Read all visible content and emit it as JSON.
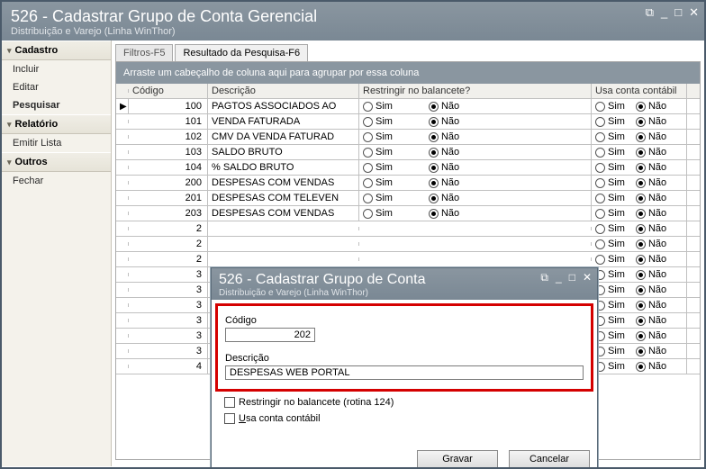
{
  "window": {
    "title": "526 - Cadastrar Grupo de Conta Gerencial",
    "subtitle": "Distribuição e Varejo (Linha WinThor)"
  },
  "sidebar": {
    "groups": [
      {
        "label": "Cadastro",
        "items": [
          {
            "label": "Incluir"
          },
          {
            "label": "Editar"
          },
          {
            "label": "Pesquisar",
            "active": true
          }
        ]
      },
      {
        "label": "Relatório",
        "items": [
          {
            "label": "Emitir Lista"
          }
        ]
      },
      {
        "label": "Outros",
        "items": [
          {
            "label": "Fechar"
          }
        ]
      }
    ]
  },
  "tabs": [
    {
      "label": "Filtros-F5",
      "active": false
    },
    {
      "label": "Resultado da Pesquisa-F6",
      "active": true
    }
  ],
  "groupbar": "Arraste um cabeçalho de coluna aqui para agrupar por essa coluna",
  "columns": {
    "codigo": "Código",
    "descricao": "Descrição",
    "restringir": "Restringir no balancete?",
    "contabil": "Usa conta contábil"
  },
  "radio_labels": {
    "sim": "Sim",
    "nao": "Não"
  },
  "rows": [
    {
      "codigo": "100",
      "descricao": "PAGTOS ASSOCIADOS AO",
      "restr": "nao",
      "conta": "nao",
      "mark": true
    },
    {
      "codigo": "101",
      "descricao": "VENDA FATURADA",
      "restr": "nao",
      "conta": "nao"
    },
    {
      "codigo": "102",
      "descricao": "CMV DA VENDA FATURAD",
      "restr": "nao",
      "conta": "nao"
    },
    {
      "codigo": "103",
      "descricao": "SALDO BRUTO",
      "restr": "nao",
      "conta": "nao"
    },
    {
      "codigo": "104",
      "descricao": "% SALDO BRUTO",
      "restr": "nao",
      "conta": "nao"
    },
    {
      "codigo": "200",
      "descricao": "DESPESAS COM VENDAS",
      "restr": "nao",
      "conta": "nao"
    },
    {
      "codigo": "201",
      "descricao": "DESPESAS COM TELEVEN",
      "restr": "nao",
      "conta": "nao"
    },
    {
      "codigo": "203",
      "descricao": "DESPESAS COM VENDAS",
      "restr": "nao",
      "conta": "nao"
    },
    {
      "codigo": "2",
      "descricao": "",
      "restr": "",
      "conta": "nao"
    },
    {
      "codigo": "2",
      "descricao": "",
      "restr": "",
      "conta": "nao"
    },
    {
      "codigo": "2",
      "descricao": "",
      "restr": "",
      "conta": "nao"
    },
    {
      "codigo": "3",
      "descricao": "",
      "restr": "",
      "conta": "nao"
    },
    {
      "codigo": "3",
      "descricao": "",
      "restr": "",
      "conta": "nao"
    },
    {
      "codigo": "3",
      "descricao": "",
      "restr": "",
      "conta": "nao"
    },
    {
      "codigo": "3",
      "descricao": "",
      "restr": "",
      "conta": "nao"
    },
    {
      "codigo": "3",
      "descricao": "",
      "restr": "",
      "conta": "nao"
    },
    {
      "codigo": "3",
      "descricao": "",
      "restr": "",
      "conta": "nao"
    },
    {
      "codigo": "4",
      "descricao": "",
      "restr": "",
      "conta": "nao"
    }
  ],
  "dialog": {
    "title": "526 - Cadastrar Grupo de Conta",
    "subtitle": "Distribuição e Varejo (Linha WinThor)",
    "codigo_label": "Código",
    "codigo_value": "202",
    "descricao_label": "Descrição",
    "descricao_value": "DESPESAS WEB PORTAL",
    "chk_restringir": "Restringir no balancete (rotina 124)",
    "chk_contabil_prefix": "U",
    "chk_contabil_rest": "sa conta contábil",
    "btn_gravar": "Gravar",
    "btn_cancelar": "Cancelar"
  }
}
